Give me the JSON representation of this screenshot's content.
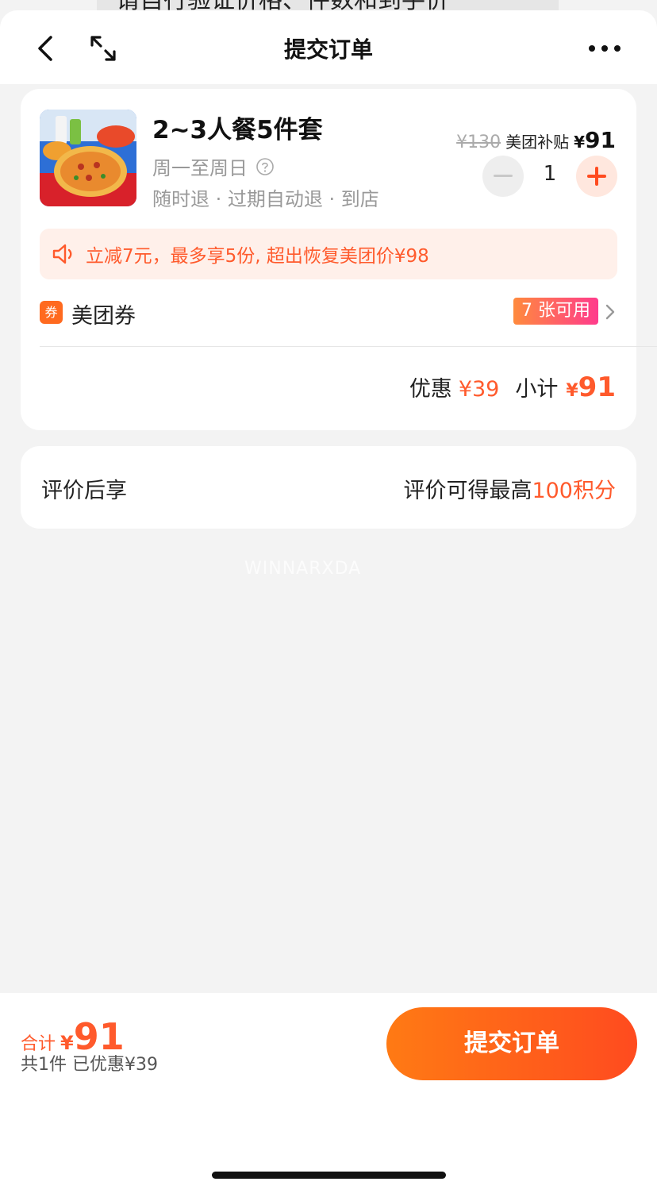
{
  "status_banner": {
    "text": "请自行验证价格、件数和到手价"
  },
  "header": {
    "title": "提交订单"
  },
  "product": {
    "name": "2~3人餐5件套",
    "days": "周一至周日",
    "tags": "随时退 · 过期自动退 · 到店",
    "original_price": "¥130",
    "subsidy_label": "美团补贴",
    "price_symbol": "¥",
    "price": "91",
    "quantity": "1"
  },
  "notice": {
    "text": "立减7元，最多享5份, 超出恢复美团价¥98"
  },
  "coupon": {
    "icon_text": "券",
    "label": "美团券",
    "badge": "7 张可用"
  },
  "summary": {
    "discount_label": "优惠",
    "discount_value": "¥39",
    "subtotal_label": "小计",
    "subtotal_symbol": "¥",
    "subtotal_value": "91"
  },
  "review": {
    "left": "评价后享",
    "right_prefix": "评价可得最高",
    "right_highlight": "100积分"
  },
  "watermark": "WINNARXDA",
  "footer": {
    "total_label": "合计",
    "total_symbol": "¥",
    "total_value": "91",
    "count_text": "共1件  已优惠¥39",
    "submit_label": "提交订单"
  },
  "colors": {
    "accent": "#ff5a2c",
    "button_start": "#ff7a14",
    "button_end": "#ff4b1f"
  }
}
